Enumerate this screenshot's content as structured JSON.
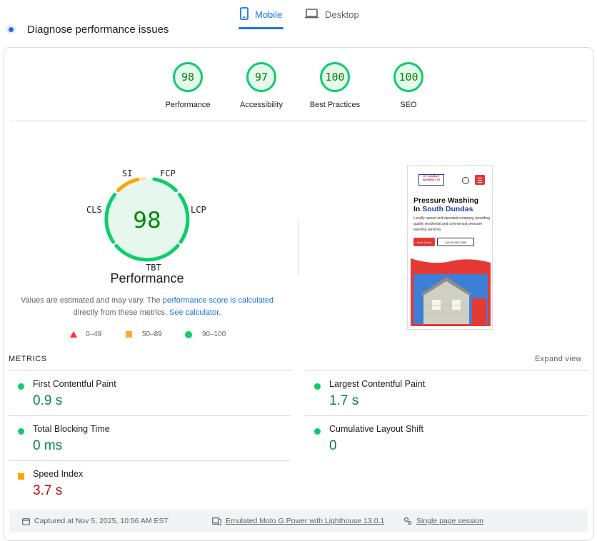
{
  "tabs": [
    {
      "label": "Mobile",
      "icon": "smartphone-icon",
      "active": true
    },
    {
      "label": "Desktop",
      "icon": "laptop-icon",
      "active": false
    }
  ],
  "diagnose_heading": "Diagnose performance issues",
  "categories": [
    {
      "score": "98",
      "label": "Performance"
    },
    {
      "score": "97",
      "label": "Accessibility"
    },
    {
      "score": "100",
      "label": "Best Practices"
    },
    {
      "score": "100",
      "label": "SEO"
    }
  ],
  "performance_gauge": {
    "score": "98",
    "title": "Performance",
    "metric_letters": {
      "si": "SI",
      "fcp": "FCP",
      "lcp": "LCP",
      "tbt": "TBT",
      "cls": "CLS"
    }
  },
  "note": {
    "text_before": "Values are estimated and may vary. The",
    "link1": "performance score is calculated",
    "text_middle": "directly from these metrics.",
    "link2": "See calculator."
  },
  "legend": [
    {
      "range": "0–49",
      "color": "#ff3333"
    },
    {
      "range": "50–89",
      "color": "#ffaa33"
    },
    {
      "range": "90–100",
      "color": "#0cce6b"
    }
  ],
  "thumbnail": {
    "logo_text": "KY's MOBILE WASHING LTD",
    "headline_1": "Pressure Washing",
    "headline_2_prefix": "In",
    "headline_2_highlight": "South Dundas",
    "paragraph": "Locally owned and operated company, providing quality residential and commercial pressure washing services.",
    "btn_quote": "Free Quote",
    "btn_phone": "1-(613) 662-5394"
  },
  "metrics_section": {
    "heading": "METRICS",
    "expand": "Expand view",
    "items": [
      {
        "name": "First Contentful Paint",
        "value": "0.9 s",
        "status": "good"
      },
      {
        "name": "Largest Contentful Paint",
        "value": "1.7 s",
        "status": "good"
      },
      {
        "name": "Total Blocking Time",
        "value": "0 ms",
        "status": "good"
      },
      {
        "name": "Cumulative Layout Shift",
        "value": "0",
        "status": "good"
      },
      {
        "name": "Speed Index",
        "value": "3.7 s",
        "status": "average"
      }
    ]
  },
  "footer": {
    "captured": "Captured at Nov 5, 2025, 10:56 AM EST",
    "emulated": "Emulated Moto G Power with Lighthouse 13.0.1",
    "session": "Single page session"
  },
  "colors": {
    "accent": "#1a73e8",
    "pass": "#0cce6b",
    "average": "#ffa400",
    "fail": "#ff3333"
  }
}
